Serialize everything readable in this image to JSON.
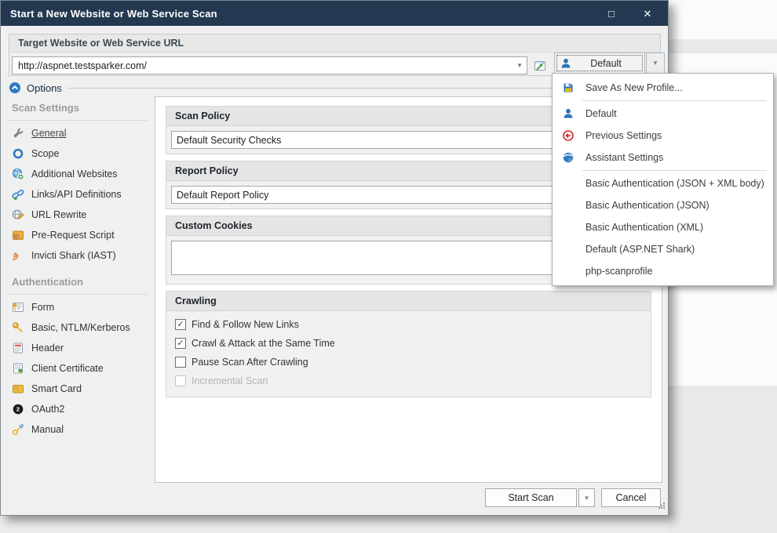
{
  "window": {
    "title": "Start a New Website or Web Service Scan"
  },
  "glyphs": {
    "maximize": "□",
    "close": "✕",
    "chevron_down": "▼",
    "check": "✓"
  },
  "target": {
    "header": "Target Website or Web Service URL",
    "url_value": "http://aspnet.testsparker.com/",
    "profile_label": "Default"
  },
  "options": {
    "label": "Options"
  },
  "sidebar": {
    "groups": [
      {
        "title": "Scan Settings",
        "items": [
          {
            "label": "General",
            "icon": "wrench-icon",
            "selected": true
          },
          {
            "label": "Scope",
            "icon": "scope-icon"
          },
          {
            "label": "Additional Websites",
            "icon": "globe-plus-icon"
          },
          {
            "label": "Links/API Definitions",
            "icon": "chain-link-icon"
          },
          {
            "label": "URL Rewrite",
            "icon": "globe-pencil-icon"
          },
          {
            "label": "Pre-Request Script",
            "icon": "script-icon"
          },
          {
            "label": "Invicti Shark (IAST)",
            "icon": "shark-waves-icon"
          }
        ]
      },
      {
        "title": "Authentication",
        "items": [
          {
            "label": "Form",
            "icon": "form-key-icon"
          },
          {
            "label": "Basic, NTLM/Kerberos",
            "icon": "key-icon"
          },
          {
            "label": "Header",
            "icon": "header-doc-icon"
          },
          {
            "label": "Client Certificate",
            "icon": "certificate-icon"
          },
          {
            "label": "Smart Card",
            "icon": "smart-card-icon"
          },
          {
            "label": "OAuth2",
            "icon": "oauth2-icon"
          },
          {
            "label": "Manual",
            "icon": "key-pencil-icon"
          }
        ]
      }
    ]
  },
  "panel": {
    "scan_policy": {
      "title": "Scan Policy",
      "value": "Default Security Checks"
    },
    "report_policy": {
      "title": "Report Policy",
      "value": "Default Report Policy"
    },
    "custom_cookies": {
      "title": "Custom Cookies",
      "value": ""
    },
    "crawling": {
      "title": "Crawling",
      "checkboxes": [
        {
          "label": "Find & Follow New Links",
          "checked": true,
          "disabled": false
        },
        {
          "label": "Crawl & Attack at the Same Time",
          "checked": true,
          "disabled": false
        },
        {
          "label": "Pause Scan After Crawling",
          "checked": false,
          "disabled": false
        },
        {
          "label": "Incremental Scan",
          "checked": false,
          "disabled": true
        }
      ]
    }
  },
  "footer": {
    "start_scan": "Start Scan",
    "cancel": "Cancel"
  },
  "profile_menu": {
    "items": [
      {
        "label": "Save As New Profile...",
        "icon": "save-icon"
      },
      {
        "label": "Default",
        "icon": "user-icon"
      },
      {
        "label": "Previous Settings",
        "icon": "previous-settings-icon"
      },
      {
        "label": "Assistant Settings",
        "icon": "assistant-settings-icon"
      },
      {
        "label": "Basic Authentication (JSON + XML body)"
      },
      {
        "label": "Basic Authentication (JSON)"
      },
      {
        "label": "Basic Authentication (XML)"
      },
      {
        "label": "Default (ASP.NET Shark)"
      },
      {
        "label": "php-scanprofile"
      }
    ]
  },
  "colors": {
    "titlebar_bg": "#243951",
    "accent_blue": "#2e74b5",
    "dialog_bg": "#f0f0f0",
    "section_header_bg": "#e5e5e5",
    "green_accent": "#3aa13a",
    "gold_accent": "#e8b62c",
    "orange_accent": "#e8702a",
    "red_accent": "#cf2a27"
  }
}
